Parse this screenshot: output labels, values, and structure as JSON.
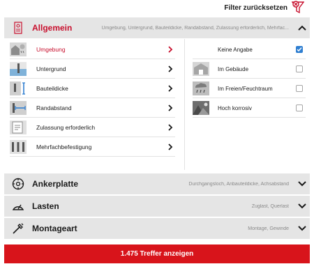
{
  "toolbar": {
    "reset_label": "Filter zurücksetzen",
    "reset_icon": "filter-reset-icon"
  },
  "colors": {
    "accent": "#c8102e",
    "cta": "#d8141b",
    "header_bg": "#e5e5e5",
    "checkbox_checked": "#2f7fd1"
  },
  "sections": [
    {
      "title": "Allgemein",
      "summary": "Umgebung, Untergrund, Bauteildicke, Randabstand, Zulassung erforderlich, Mehrfac...",
      "icon": "document-certificate-icon",
      "expanded": true
    },
    {
      "title": "Ankerplatte",
      "summary": "Durchgangsloch, Anbauteildicke, Achsabstand",
      "icon": "anchor-plate-icon",
      "expanded": false
    },
    {
      "title": "Lasten",
      "summary": "Zuglast, Querlast",
      "icon": "load-gauge-icon",
      "expanded": false
    },
    {
      "title": "Montageart",
      "summary": "Montage, Gewinde",
      "icon": "mounting-tool-icon",
      "expanded": false
    }
  ],
  "general_items": [
    {
      "label": "Umgebung",
      "icon": "environment-icon",
      "selected": true
    },
    {
      "label": "Untergrund",
      "icon": "substrate-icon",
      "selected": false
    },
    {
      "label": "Bauteildicke",
      "icon": "component-thickness-icon",
      "selected": false
    },
    {
      "label": "Randabstand",
      "icon": "edge-distance-icon",
      "selected": false
    },
    {
      "label": "Zulassung erforderlich",
      "icon": "approval-required-icon",
      "selected": false
    },
    {
      "label": "Mehrfachbefestigung",
      "icon": "multiple-fastening-icon",
      "selected": false
    }
  ],
  "environment_options": [
    {
      "label": "Keine Angabe",
      "icon": "",
      "checked": true
    },
    {
      "label": "Im Gebäude",
      "icon": "indoor-icon",
      "checked": false
    },
    {
      "label": "Im Freien/Feuchtraum",
      "icon": "outdoor-wet-icon",
      "checked": false
    },
    {
      "label": "Hoch korrosiv",
      "icon": "corrosive-icon",
      "checked": false
    }
  ],
  "cta_label": "1.475 Treffer anzeigen"
}
